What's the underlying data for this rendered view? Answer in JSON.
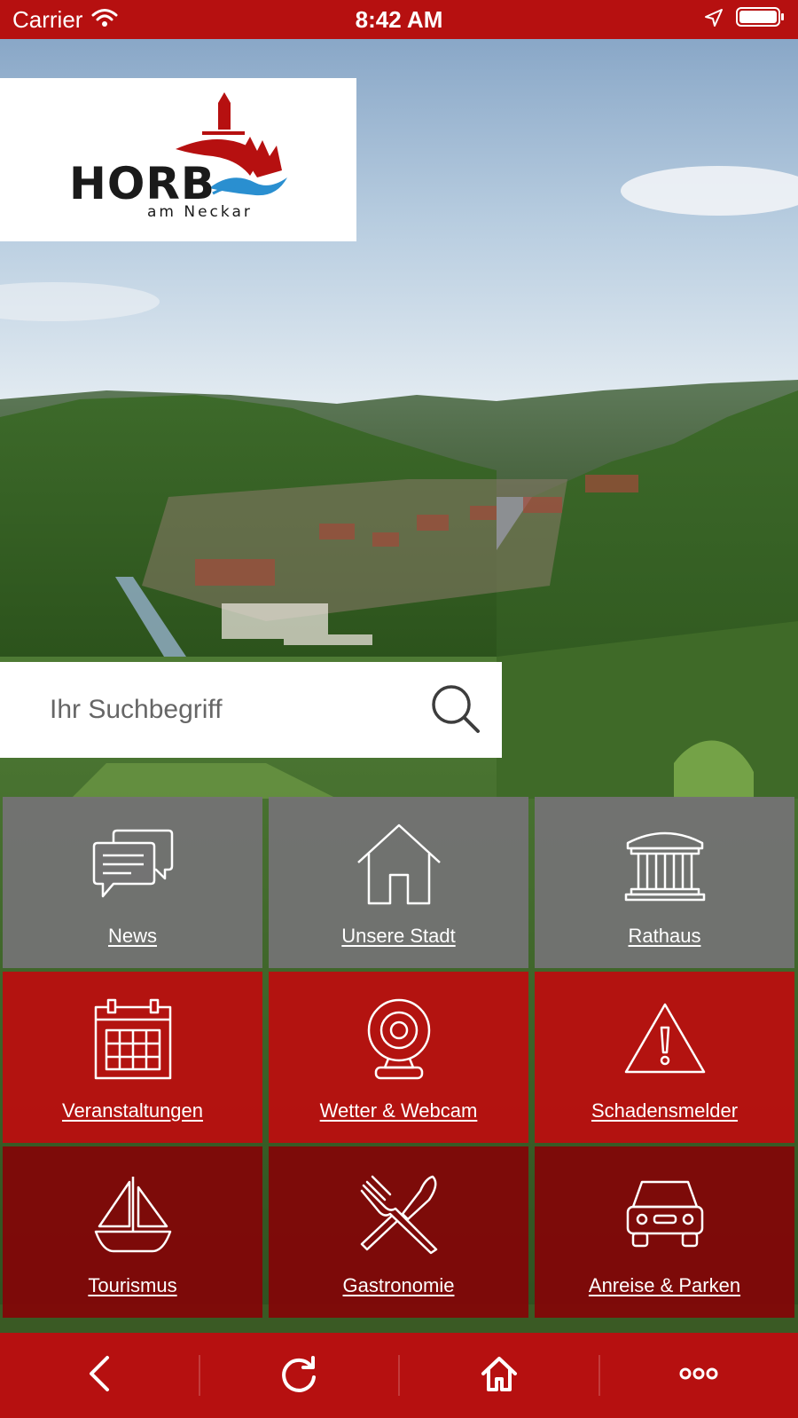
{
  "status_bar": {
    "carrier": "Carrier",
    "time": "8:42 AM",
    "color": "#b61010"
  },
  "logo": {
    "wordmark": "HORB",
    "subline": "am Neckar",
    "brand_red": "#b61010",
    "water_blue": "#2a8fd0"
  },
  "search": {
    "placeholder": "Ihr Suchbegriff",
    "value": "",
    "icon": "search-icon"
  },
  "tiles": [
    {
      "label": "News",
      "icon": "speech-bubbles-icon",
      "color": "rgba(115,115,115,0.96)"
    },
    {
      "label": "Unsere Stadt",
      "icon": "house-icon",
      "color": "rgba(115,115,115,0.96)"
    },
    {
      "label": "Rathaus",
      "icon": "town-hall-icon",
      "color": "rgba(115,115,115,0.96)"
    },
    {
      "label": "Veranstaltungen",
      "icon": "calendar-icon",
      "color": "rgba(184,16,16,0.96)"
    },
    {
      "label": "Wetter & Webcam",
      "icon": "webcam-icon",
      "color": "rgba(184,16,16,0.96)"
    },
    {
      "label": "Schadensmelder",
      "icon": "warning-icon",
      "color": "rgba(184,16,16,0.96)"
    },
    {
      "label": "Tourismus",
      "icon": "sailboat-icon",
      "color": "rgba(128,8,8,0.97)"
    },
    {
      "label": "Gastronomie",
      "icon": "fork-knife-icon",
      "color": "rgba(128,8,8,0.97)"
    },
    {
      "label": "Anreise & Parken",
      "icon": "car-icon",
      "color": "rgba(128,8,8,0.97)"
    }
  ],
  "bottom_nav": [
    {
      "icon": "back-chevron-icon"
    },
    {
      "icon": "reload-icon"
    },
    {
      "icon": "home-icon"
    },
    {
      "icon": "more-dots-icon"
    }
  ]
}
